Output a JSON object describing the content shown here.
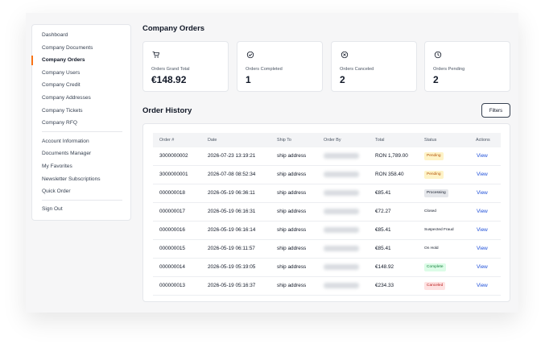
{
  "sidebar": {
    "items": [
      {
        "label": "Dashboard"
      },
      {
        "label": "Company Documents"
      },
      {
        "label": "Company Orders",
        "active": true
      },
      {
        "label": "Company Users"
      },
      {
        "label": "Company Credit"
      },
      {
        "label": "Company Addresses"
      },
      {
        "label": "Company Tickets"
      },
      {
        "label": "Company RFQ"
      }
    ],
    "account_items": [
      {
        "label": "Account Information"
      },
      {
        "label": "Documents Manager"
      },
      {
        "label": "My Favorites"
      },
      {
        "label": "Newsletter Subscriptions"
      },
      {
        "label": "Quick Order"
      }
    ],
    "sign_out": "Sign Out"
  },
  "page_title": "Company Orders",
  "stats": [
    {
      "icon": "cart-icon",
      "label": "Orders Grand Total",
      "value": "€148.92"
    },
    {
      "icon": "check-circle-icon",
      "label": "Orders Completed",
      "value": "1"
    },
    {
      "icon": "x-circle-icon",
      "label": "Orders Canceled",
      "value": "2"
    },
    {
      "icon": "clock-icon",
      "label": "Orders Pending",
      "value": "2"
    }
  ],
  "order_history": {
    "title": "Order History",
    "filters_label": "Filters",
    "columns": [
      "Order #",
      "Date",
      "Ship To",
      "Order By",
      "Total",
      "Status",
      "Actions"
    ],
    "rows": [
      {
        "order": "3000000002",
        "date": "2026-07-23 13:19:21",
        "ship_to": "ship address",
        "total": "RON 1,789.00",
        "status": "Pending",
        "status_kind": "pending",
        "action": "View"
      },
      {
        "order": "3000000001",
        "date": "2026-07-08 08:52:34",
        "ship_to": "ship address",
        "total": "RON 358.40",
        "status": "Pending",
        "status_kind": "pending",
        "action": "View"
      },
      {
        "order": "000000018",
        "date": "2026-05-19 06:36:11",
        "ship_to": "ship address",
        "total": "€85.41",
        "status": "Processing",
        "status_kind": "processing",
        "action": "View"
      },
      {
        "order": "000000017",
        "date": "2026-05-19 06:16:31",
        "ship_to": "ship address",
        "total": "€72.27",
        "status": "Closed",
        "status_kind": "plain",
        "action": "View"
      },
      {
        "order": "000000016",
        "date": "2026-05-19 06:16:14",
        "ship_to": "ship address",
        "total": "€85.41",
        "status": "Suspected Fraud",
        "status_kind": "plain",
        "action": "View"
      },
      {
        "order": "000000015",
        "date": "2026-05-19 06:11:57",
        "ship_to": "ship address",
        "total": "€85.41",
        "status": "On Hold",
        "status_kind": "plain",
        "action": "View"
      },
      {
        "order": "000000014",
        "date": "2026-05-19 05:19:05",
        "ship_to": "ship address",
        "total": "€148.92",
        "status": "Complete",
        "status_kind": "complete",
        "action": "View"
      },
      {
        "order": "000000013",
        "date": "2026-05-19 05:16:37",
        "ship_to": "ship address",
        "total": "€234.33",
        "status": "Canceled",
        "status_kind": "canceled",
        "action": "View"
      }
    ]
  },
  "colors": {
    "accent": "#f97316",
    "link": "#1d4ed8",
    "pending_bg": "#fef3c7",
    "pending_fg": "#b45309",
    "processing_bg": "#e5e7eb",
    "complete_bg": "#dcfce7",
    "complete_fg": "#15803d",
    "canceled_bg": "#fee2e2",
    "canceled_fg": "#b91c1c"
  }
}
